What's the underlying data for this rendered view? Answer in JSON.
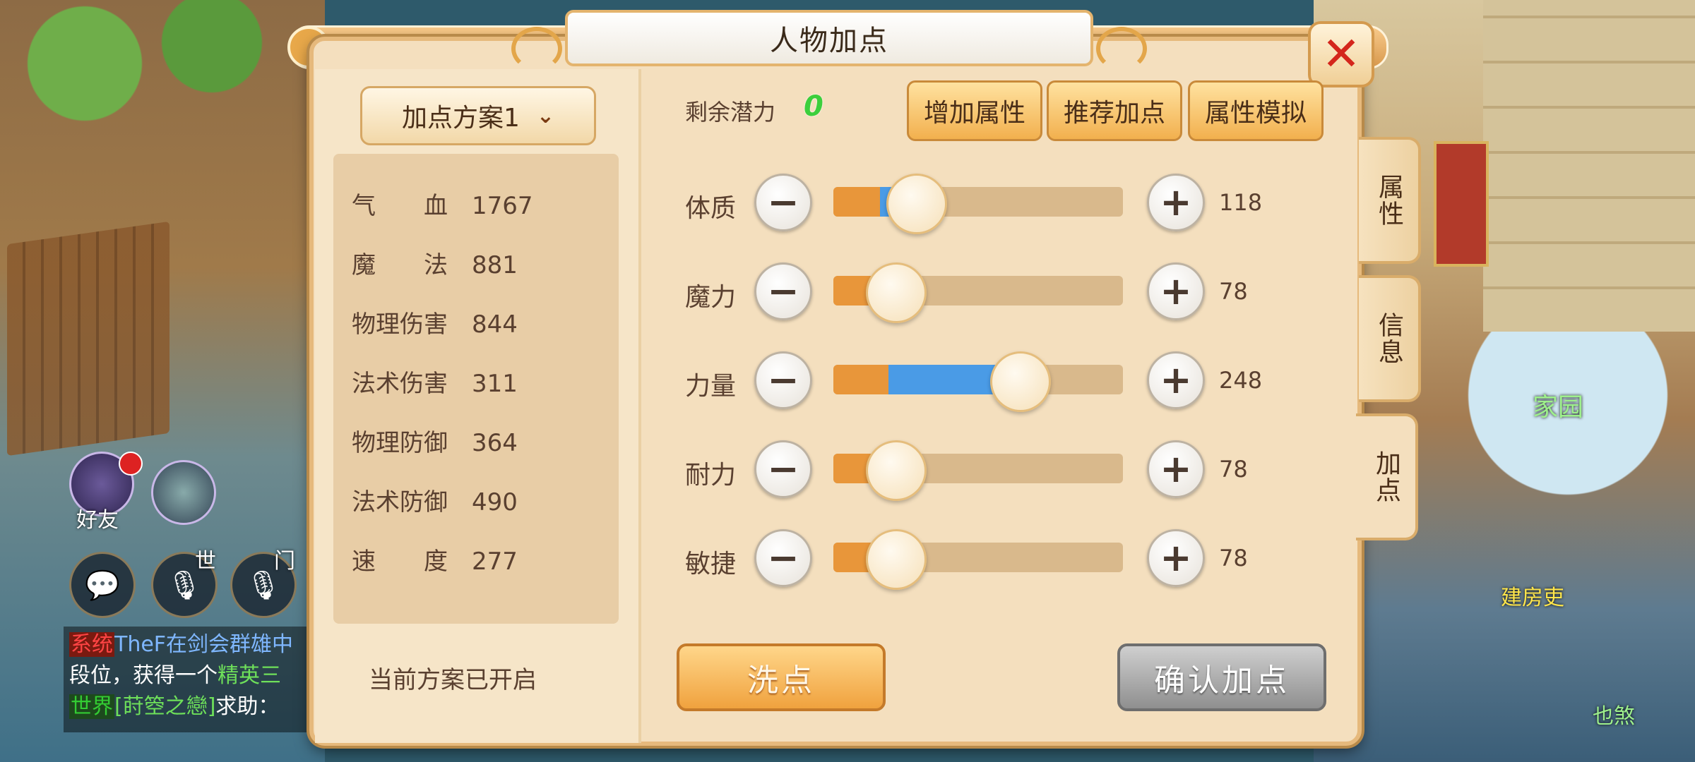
{
  "window": {
    "title": "人物加点"
  },
  "scheme": {
    "label": "加点方案1",
    "status": "当前方案已开启"
  },
  "stats": [
    {
      "name": "气　　血",
      "value": "1767"
    },
    {
      "name": "魔　　法",
      "value": "881"
    },
    {
      "name": "物理伤害",
      "value": "844"
    },
    {
      "name": "法术伤害",
      "value": "311"
    },
    {
      "name": "物理防御",
      "value": "364"
    },
    {
      "name": "法术防御",
      "value": "490"
    },
    {
      "name": "速　　度",
      "value": "277"
    }
  ],
  "potential": {
    "label": "剩余潜力",
    "value": "0"
  },
  "toolbar": {
    "add_attr": "增加属性",
    "recommend": "推荐加点",
    "simulate": "属性模拟"
  },
  "attributes": [
    {
      "name": "体质",
      "value": "118",
      "base_fraction": 0.16,
      "added_fraction": 0.07
    },
    {
      "name": "魔力",
      "value": "78",
      "base_fraction": 0.16,
      "added_fraction": 0.0
    },
    {
      "name": "力量",
      "value": "248",
      "base_fraction": 0.19,
      "added_fraction": 0.4
    },
    {
      "name": "耐力",
      "value": "78",
      "base_fraction": 0.16,
      "added_fraction": 0.0
    },
    {
      "name": "敏捷",
      "value": "78",
      "base_fraction": 0.16,
      "added_fraction": 0.0
    }
  ],
  "buttons": {
    "minus": "−",
    "plus": "+",
    "wash": "洗点",
    "confirm": "确认加点"
  },
  "tabs": [
    "属性",
    "信息",
    "加点"
  ],
  "active_tab": "加点",
  "hud": {
    "friend_label": "好友",
    "world_short": "世",
    "sect_short": "门",
    "home_label": "家园",
    "npc_name": "建房吏",
    "npc_name2": "也煞",
    "chat": {
      "line1_tag": "系统",
      "line1_text": "TheF在剑会群雄中",
      "line2_text_a": "段位，获得一个",
      "line2_text_b": "精英三",
      "line3_tag": "世界",
      "line3_text_a": "[莳箜之戀]",
      "line3_text_b": "求助："
    }
  },
  "colors": {
    "base_fill": "#e8963a",
    "added_fill": "#4a9be6",
    "potential": "#3ccf3c",
    "close": "#d4261c"
  }
}
